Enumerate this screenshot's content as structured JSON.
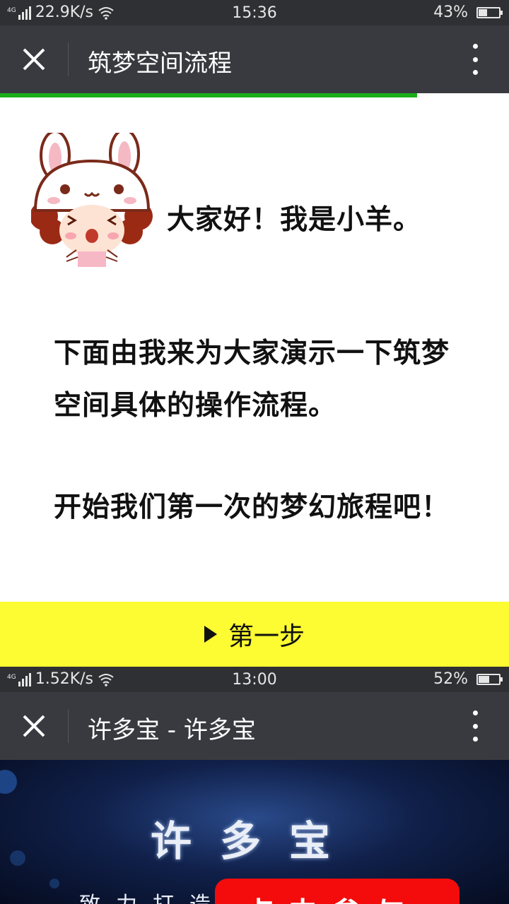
{
  "screen1": {
    "status": {
      "speed": "22.9K/s",
      "time": "15:36",
      "battery": "43%",
      "battery_level": 0.43,
      "network": "4G"
    },
    "nav": {
      "title": "筑梦空间流程"
    },
    "progress": 0.82,
    "greeting": "大家好！我是小羊。",
    "paragraph1_line1": "下面由我来为大家演示一下筑梦",
    "paragraph1_line2": "空间具体的操作流程。",
    "paragraph2": "开始我们第一次的梦幻旅程吧！",
    "step_button": "第一步"
  },
  "screen2": {
    "status": {
      "speed": "1.52K/s",
      "time": "13:00",
      "battery": "52%",
      "battery_level": 0.52,
      "network": "4G"
    },
    "nav": {
      "title": "许多宝 - 许多宝"
    },
    "banner_brand": "许多宝",
    "banner_sub": "致力打造",
    "banner_button": "点击参与"
  },
  "icons": [
    "close-icon",
    "more-icon",
    "signal-icon",
    "wifi-icon",
    "battery-icon",
    "play-arrow-icon",
    "rabbit-mascot"
  ],
  "colors": {
    "status_bg": "#2e3033",
    "nav_bg": "#393a3f",
    "progress": "#1aad19",
    "step_bar": "#fdfb31",
    "banner_button": "#f40c0c"
  }
}
